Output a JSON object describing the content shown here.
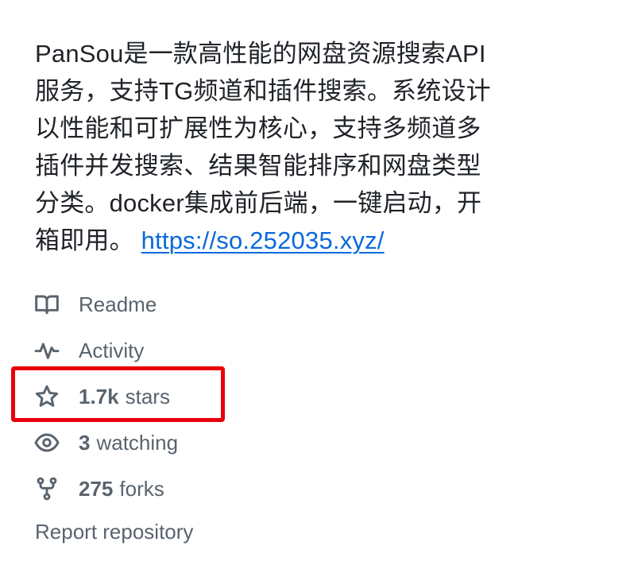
{
  "about": {
    "description_lines": [
      "PanSou是一款高性能的网盘资源搜索API",
      "服务，支持TG频道和插件搜索。系统设计",
      "以性能和可扩展性为核心，支持多频道多",
      "插件并发搜索、结果智能排序和网盘类型",
      "分类。docker集成前后端，一键启动，开"
    ],
    "last_line_prefix": "箱即用。",
    "link_text": "https://so.252035.xyz/",
    "link_color": "#0969da"
  },
  "meta": {
    "readme": {
      "label": "Readme",
      "icon": "book-icon"
    },
    "activity": {
      "label": "Activity",
      "icon": "pulse-icon"
    },
    "stars": {
      "count": "1.7k",
      "label": "stars",
      "icon": "star-icon"
    },
    "watching": {
      "count": "3",
      "label": "watching",
      "icon": "eye-icon"
    },
    "forks": {
      "count": "275",
      "label": "forks",
      "icon": "fork-icon"
    }
  },
  "report": {
    "label": "Report repository"
  },
  "highlight": {
    "target": "stars",
    "color": "#e8000b"
  }
}
